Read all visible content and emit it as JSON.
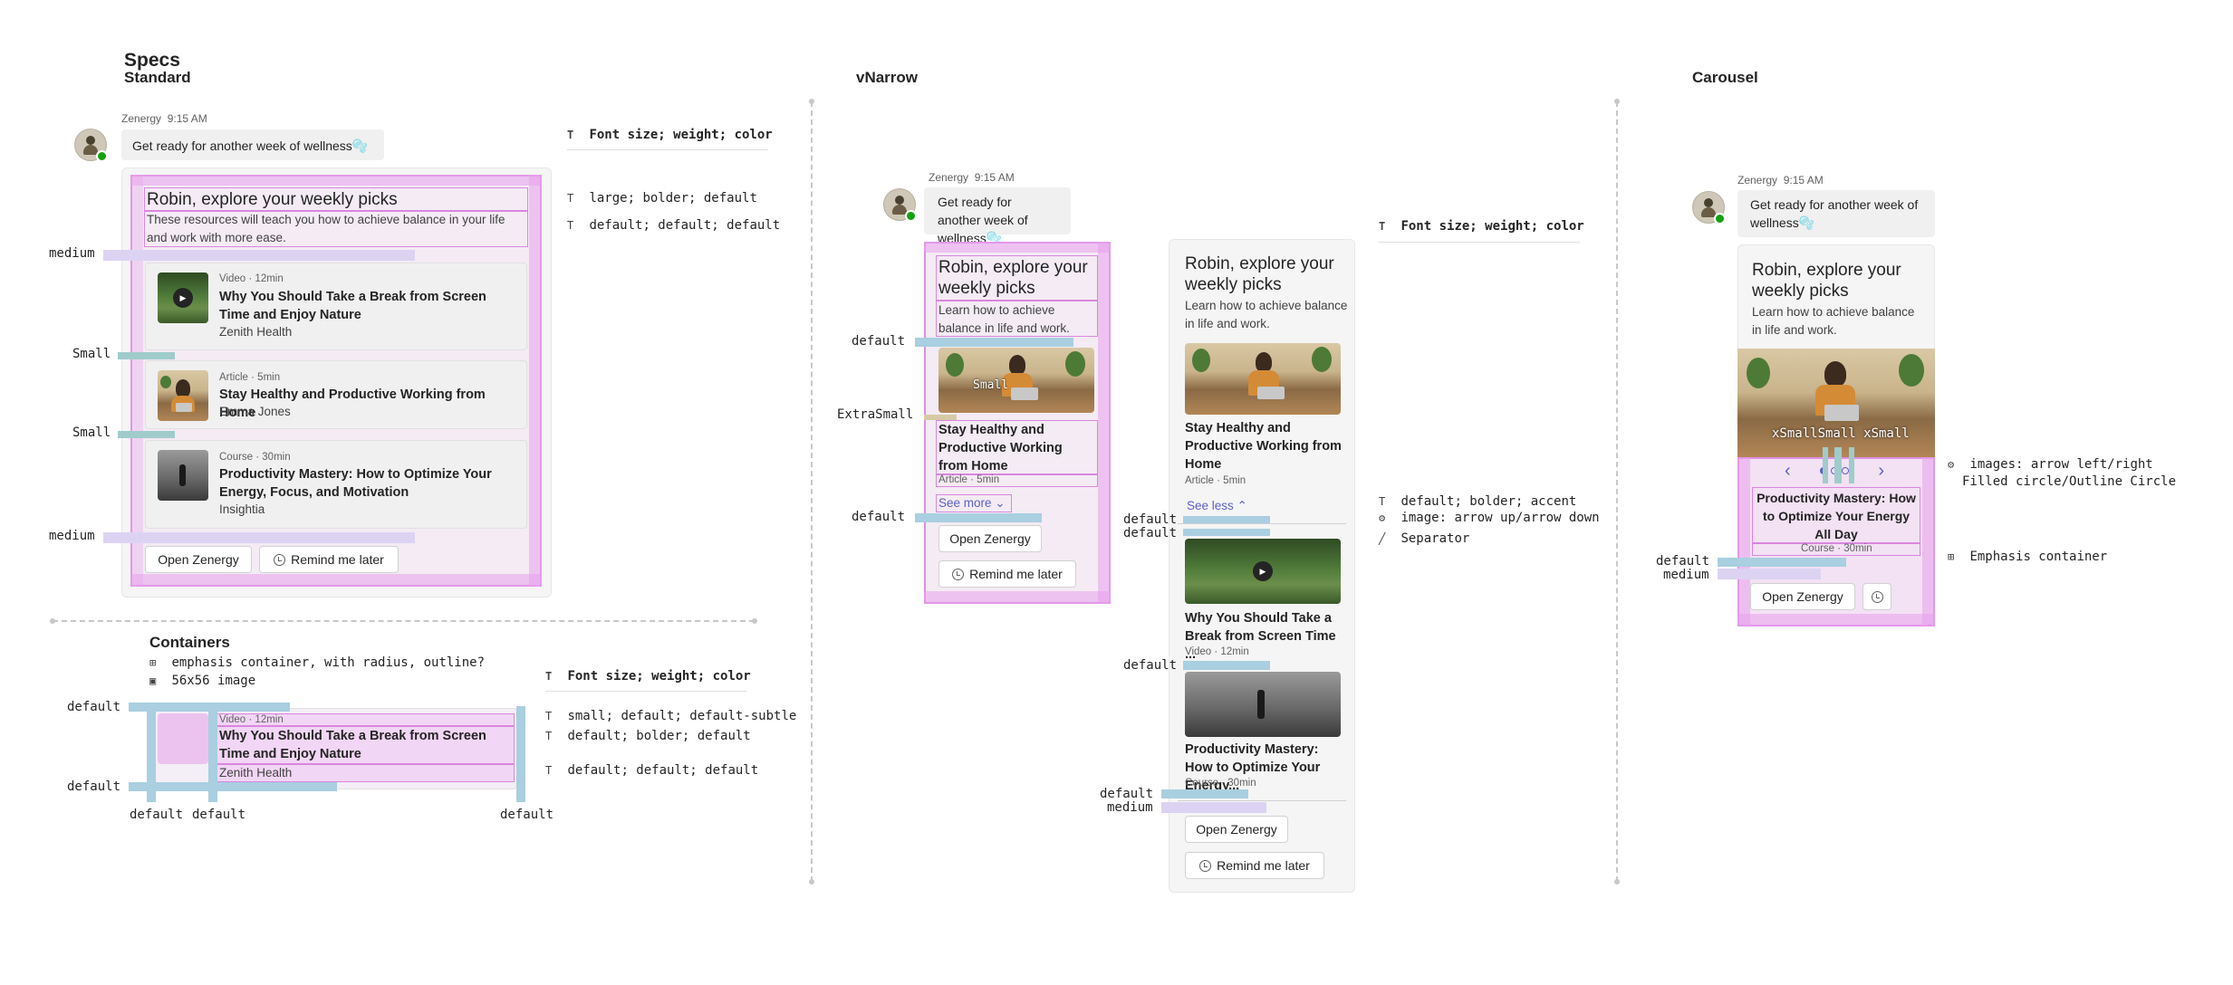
{
  "headers": {
    "specs": "Specs",
    "standard": "Standard",
    "vnarrow": "vNarrow",
    "carousel": "Carousel",
    "containers": "Containers"
  },
  "chat": {
    "sender": "Zenergy",
    "time": "9:15 AM",
    "message": "Get ready for another week of wellness",
    "message_emoji": "🫧"
  },
  "card": {
    "title": "Robin, explore your weekly picks",
    "subtitle_long": "These resources will teach you how to achieve balance in your life and work with more ease.",
    "subtitle_short": "Learn how to achieve balance in life and work.",
    "items": [
      {
        "meta": "Video · 12min",
        "title": "Why You Should Take a Break from Screen Time and Enjoy Nature",
        "title_trunc": "Why You Should Take a Break from Screen Time ...",
        "source": "Zenith Health"
      },
      {
        "meta": "Article · 5min",
        "title": "Stay Healthy and Productive Working from Home",
        "source": "Emma Jones"
      },
      {
        "meta": "Course · 30min",
        "title": "Productivity Mastery: How to Optimize Your Energy, Focus, and Motivation",
        "title_trunc": "Productivity Mastery: How to Optimize Your Energy...",
        "source": "Insightia"
      }
    ],
    "carousel_item": {
      "title": "Productivity Mastery: How to Optimize Your Energy All Day",
      "meta": "Course · 30min"
    },
    "primary_button": "Open Zenergy",
    "secondary_button": "Remind me later",
    "see_more": "See more",
    "see_less": "See less"
  },
  "spacing_labels": {
    "medium": "medium",
    "small": "Small",
    "default": "default",
    "extra_small": "ExtraSmall",
    "small_overlay": "Small",
    "carousel_overlay": "xSmallSmall xSmall"
  },
  "specs": {
    "heading": "Font size; weight; color",
    "standard_rows": [
      "large; bolder; default",
      "default; default; default"
    ],
    "vnarrow_rows": [
      "default; bolder; accent",
      "image: arrow up/arrow down",
      "Separator"
    ],
    "carousel_rows": [
      "images: arrow left/right",
      "Filled circle/Outline Circle",
      "Emphasis container"
    ],
    "container_rows": [
      "small; default; default-subtle",
      "default; bolder; default",
      "default; default; default"
    ]
  },
  "containers": {
    "emphasis": "emphasis container, with radius, outline?",
    "image": "56x56 image"
  },
  "icons": {
    "font": "T",
    "clock": "clock-icon",
    "play": "▶",
    "chevron_down": "⌄",
    "chevron_up": "⌃",
    "chevron_left": "‹",
    "chevron_right": "›"
  },
  "colors": {
    "pink_outline": "#e08fe6",
    "blue_spacer": "#a9cfe0",
    "lavender_spacer": "#dcd3f3",
    "teal_spacer": "#9fcccb",
    "accent": "#5b5fc7",
    "status_green": "#13a10e"
  }
}
